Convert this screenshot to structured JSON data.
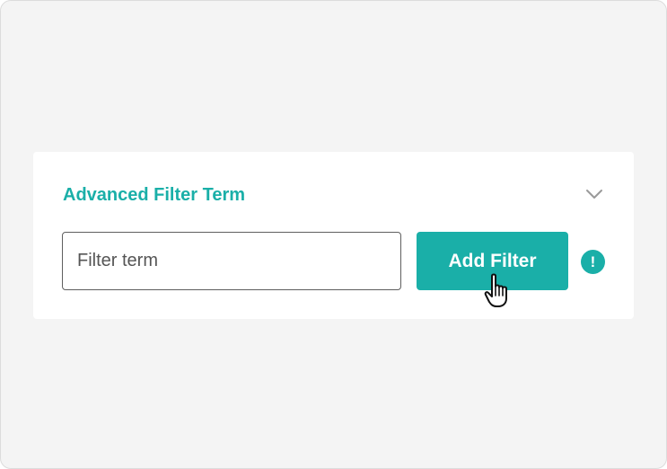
{
  "panel": {
    "title": "Advanced Filter Term",
    "toggle_icon": "chevron-down-icon"
  },
  "filter": {
    "placeholder": "Filter term",
    "value": ""
  },
  "add_button": {
    "label": "Add Filter"
  },
  "info": {
    "icon": "exclamation-icon",
    "glyph": "!"
  },
  "cursor": {
    "icon": "hand-pointer-cursor-icon"
  },
  "colors": {
    "accent": "#1aafa8",
    "background": "#f4f4f4",
    "panel": "#ffffff"
  }
}
